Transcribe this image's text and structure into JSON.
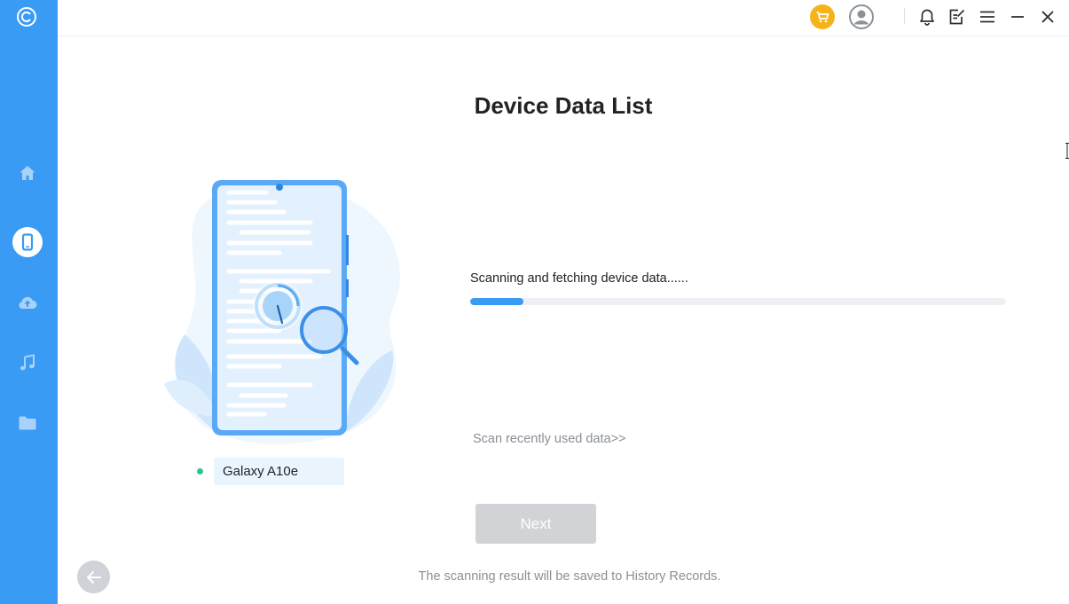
{
  "window": {
    "title": "Device Data List"
  },
  "sidebar": {
    "logo": "app-logo",
    "items": [
      {
        "id": "home",
        "icon": "home-icon",
        "active": false
      },
      {
        "id": "device",
        "icon": "phone-icon",
        "active": true
      },
      {
        "id": "cloud",
        "icon": "cloud-upload-icon",
        "active": false
      },
      {
        "id": "music",
        "icon": "music-note-icon",
        "active": false
      },
      {
        "id": "files",
        "icon": "folder-icon",
        "active": false
      }
    ]
  },
  "titlebar": {
    "buttons": [
      "cart-icon",
      "user-avatar-icon",
      "bell-icon",
      "feedback-icon",
      "menu-icon",
      "minimize-icon",
      "close-icon"
    ]
  },
  "main": {
    "device_name": "Galaxy A10e",
    "device_status_color": "#2dc58c",
    "scan_status": "Scanning and fetching device data......",
    "progress": 0.1,
    "scan_recent_link": "Scan recently used data>>",
    "next_label": "Next",
    "footer_note": "The scanning result will be saved to History Records."
  },
  "colors": {
    "accent": "#3a9bf5",
    "cart": "#f7b217",
    "disabled_button": "#d1d3d6"
  }
}
